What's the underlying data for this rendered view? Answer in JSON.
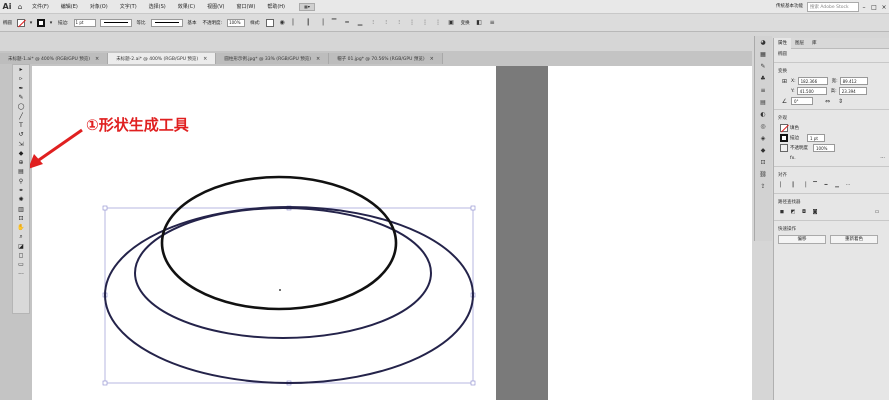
{
  "app": {
    "logo": "Ai",
    "menu": [
      "文件(F)",
      "编辑(E)",
      "对象(O)",
      "文字(T)",
      "选择(S)",
      "效果(C)",
      "视图(V)",
      "窗口(W)",
      "帮助(H)"
    ],
    "workspace": "传统基本功能",
    "search_placeholder": "搜索 Adobe Stock"
  },
  "control_bar": {
    "object_label": "椭圆",
    "stroke_label": "描边:",
    "stroke_weight": "1 pt",
    "profile_label": "等比",
    "brush_label": "基本",
    "opacity_label": "不透明度:",
    "opacity_value": "100%",
    "style_label": "样式:",
    "transform_label": "变换"
  },
  "tabs": [
    {
      "label": "未标题-1.ai* @ 400% (RGB/GPU 预览)",
      "active": false
    },
    {
      "label": "未标题-2.ai* @ 400% (RGB/GPU 预览)",
      "active": true
    },
    {
      "label": "圆柱形示例.jpg* @ 33% (RGB/GPU 预览)",
      "active": false
    },
    {
      "label": "帽子 01.jpg* @ 70.56% (RGB/GPU 预览)",
      "active": false
    }
  ],
  "tools": [
    "selection-icon",
    "direct-select-icon",
    "pen-icon",
    "brush-icon",
    "ellipse-icon",
    "line-icon",
    "type-icon",
    "rotate-icon",
    "scale-icon",
    "eraser-icon",
    "shape-builder-icon",
    "gradient-icon",
    "eyedropper-icon",
    "blend-icon",
    "symbol-icon",
    "graph-icon",
    "artboard-icon",
    "hand-icon",
    "zoom-icon",
    "fill-stroke-icon",
    "color-mode-icon",
    "screen-mode-icon",
    "more-tools-icon"
  ],
  "annotation": {
    "text": "①形状生成工具",
    "color": "#e02020"
  },
  "panel": {
    "tabs": [
      "属性",
      "图层",
      "库"
    ],
    "object": "椭圆",
    "transform_title": "变换",
    "x_label": "X:",
    "x_value": "182.366",
    "y_label": "Y:",
    "y_value": "41.500",
    "w_label": "宽:",
    "w_value": "89.412",
    "h_label": "高:",
    "h_value": "23.394",
    "angle_value": "0°",
    "appearance_title": "外观",
    "fill_label": "填色",
    "stroke_label": "描边",
    "stroke_value": "1 pt",
    "opacity_label": "不透明度",
    "opacity_value": "100%",
    "fx_label": "fx.",
    "align_title": "对齐",
    "pathfinder_title": "路径查找器",
    "quick_actions_title": "快速操作",
    "offset_button": "偏移",
    "recolor_button": "重新着色"
  },
  "colors": {
    "ellipse_black": "#111111",
    "ellipse_navy": "#24234a",
    "bbox": "#8888cc",
    "arrow": "#e02020"
  }
}
